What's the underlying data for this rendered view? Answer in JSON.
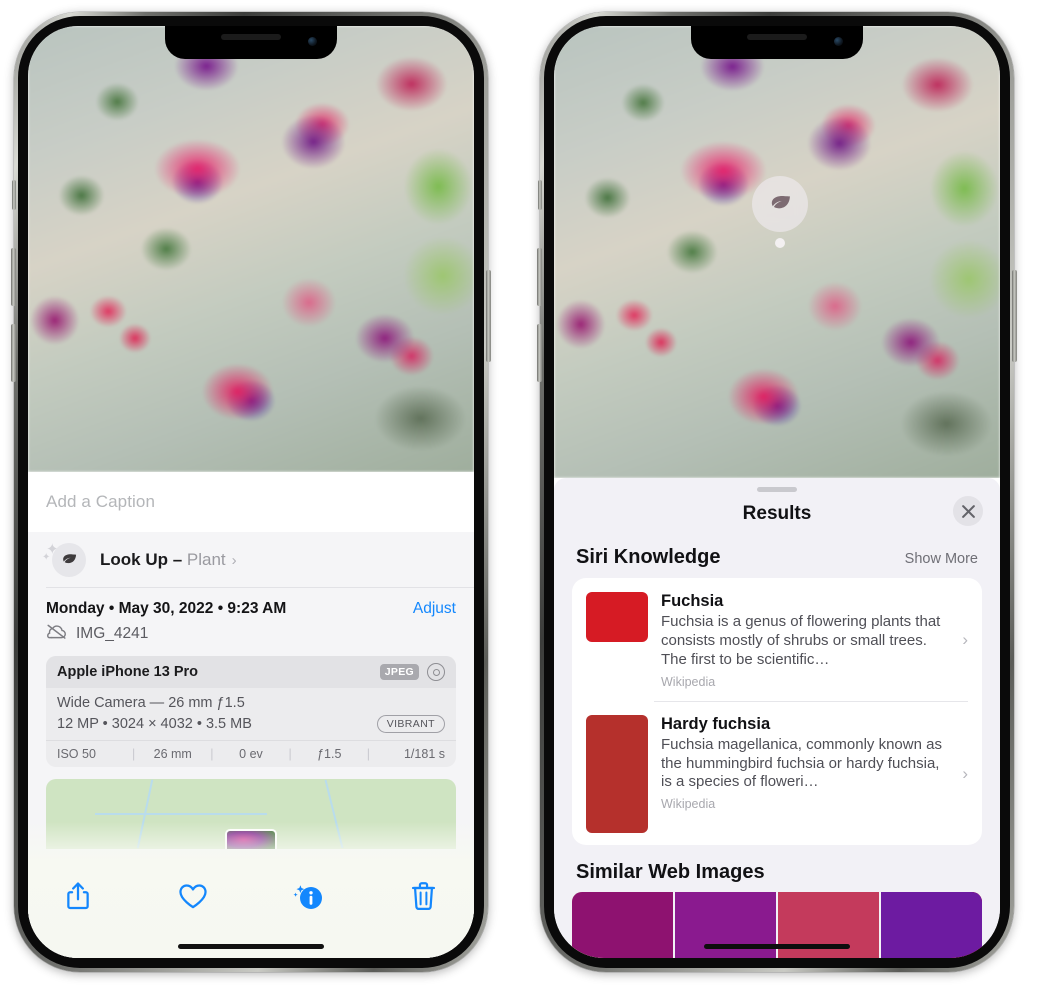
{
  "left_phone": {
    "caption_placeholder": "Add a Caption",
    "lookup": {
      "icon": "leaf-icon",
      "label": "Look Up – ",
      "subject": "Plant",
      "chevron": "›"
    },
    "date": "Monday • May 30, 2022 • 9:23 AM",
    "adjust_label": "Adjust",
    "filename": "IMG_4241",
    "cloud_icon": "icloud-slash-icon",
    "metadata": {
      "device": "Apple iPhone 13 Pro",
      "format_badge": "JPEG",
      "aperture_icon": "aperture-icon",
      "lens": "Wide Camera — 26 mm ƒ1.5",
      "resolution": "12 MP • 3024 × 4032 • 3.5 MB",
      "style_badge": "VIBRANT",
      "exif": [
        "ISO 50",
        "26 mm",
        "0 ev",
        "ƒ1.5",
        "1/181 s"
      ]
    },
    "toolbar": [
      {
        "name": "share-button",
        "icon": "share-icon"
      },
      {
        "name": "favorite-button",
        "icon": "heart-icon"
      },
      {
        "name": "info-button",
        "icon": "info-sparkle-icon"
      },
      {
        "name": "delete-button",
        "icon": "trash-icon"
      }
    ]
  },
  "right_phone": {
    "lookup_badge_icon": "leaf-icon",
    "sheet": {
      "title": "Results",
      "close_icon": "close-icon"
    },
    "siri_knowledge": {
      "title": "Siri Knowledge",
      "action": "Show More",
      "items": [
        {
          "title": "Fuchsia",
          "description": "Fuchsia is a genus of flowering plants that consists mostly of shrubs or small trees. The first to be scientific…",
          "source": "Wikipedia",
          "chevron": "›"
        },
        {
          "title": "Hardy fuchsia",
          "description": "Fuchsia magellanica, commonly known as the hummingbird fuchsia or hardy fuchsia, is a species of floweri…",
          "source": "Wikipedia",
          "chevron": "›"
        }
      ]
    },
    "similar_web_images": {
      "title": "Similar Web Images",
      "thumbnails": [
        "fuchsia-pink-white",
        "fuchsia-red-closeup",
        "fuchsia-bush",
        "fuchsia-purple-red"
      ]
    }
  },
  "colors": {
    "accent_blue": "#1387fd",
    "sheet_background": "#f2f1f6",
    "card_background": "#ffffff",
    "toolbar_background": "#f7f9f2"
  }
}
